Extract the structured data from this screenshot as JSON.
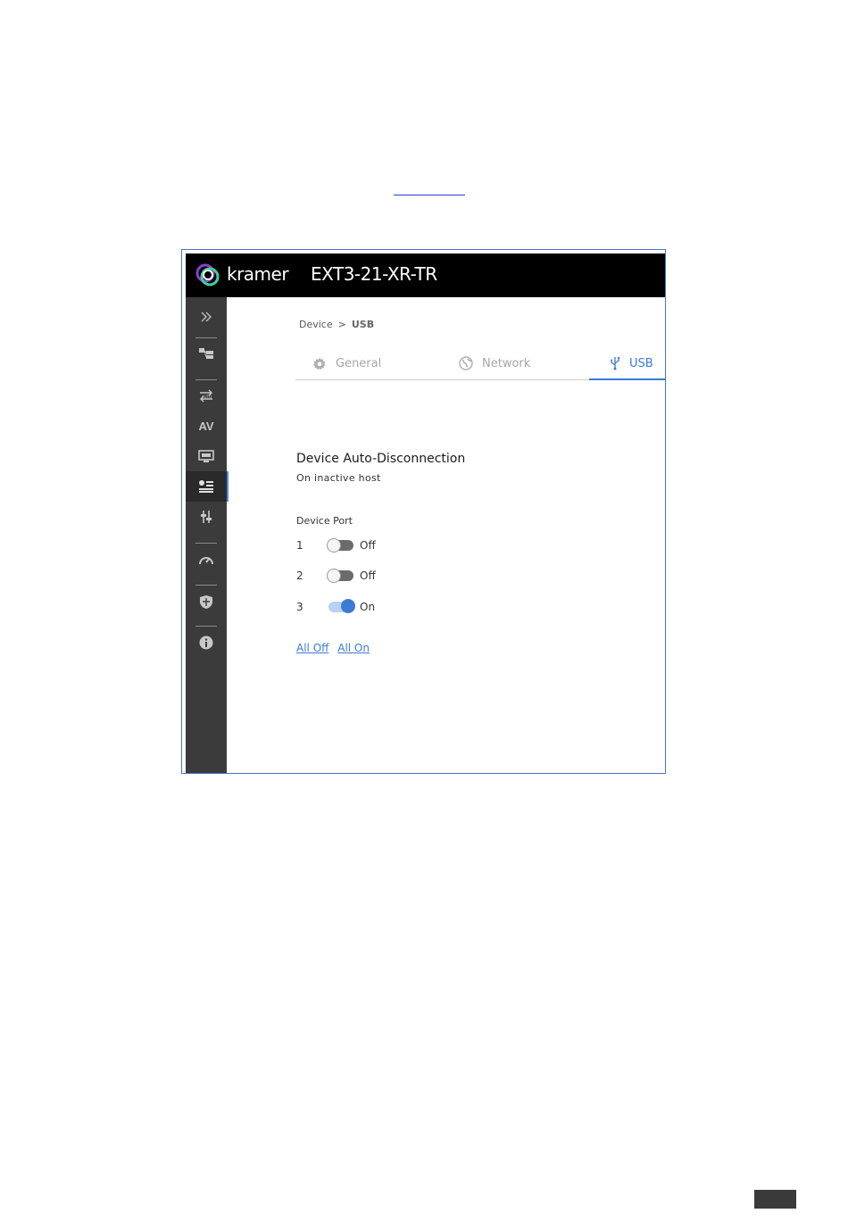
{
  "app": {
    "brand": "kramer",
    "device_name": "EXT3-21-XR-TR",
    "accent_color": "#3d7ad6",
    "header_color": "#000000",
    "sidebar_color": "#3b3b3b"
  },
  "sidebar": {
    "items": [
      {
        "name": "expand-icon",
        "active": false
      },
      {
        "name": "routing-icon",
        "active": false
      },
      {
        "name": "auto-switch-icon",
        "active": false
      },
      {
        "name": "av-icon",
        "label": "AV",
        "active": false
      },
      {
        "name": "edid-icon",
        "active": false
      },
      {
        "name": "device-settings-icon",
        "active": true
      },
      {
        "name": "control-icon",
        "active": false
      },
      {
        "name": "diagnostics-icon",
        "active": false
      },
      {
        "name": "security-icon",
        "active": false
      },
      {
        "name": "about-icon",
        "active": false
      }
    ]
  },
  "breadcrumb": {
    "root": "Device",
    "separator": ">",
    "current": "USB"
  },
  "tabs": [
    {
      "label": "General",
      "icon": "gear-icon",
      "active": false
    },
    {
      "label": "Network",
      "icon": "globe-icon",
      "active": false
    },
    {
      "label": "USB",
      "icon": "usb-icon",
      "active": true
    }
  ],
  "section": {
    "title": "Device Auto-Disconnection",
    "subtitle": "On inactive host",
    "port_header": "Device Port",
    "ports": [
      {
        "number": "1",
        "state": "Off",
        "on": false
      },
      {
        "number": "2",
        "state": "Off",
        "on": false
      },
      {
        "number": "3",
        "state": "On",
        "on": true
      }
    ],
    "all_off": "All Off",
    "all_on": "All On"
  }
}
